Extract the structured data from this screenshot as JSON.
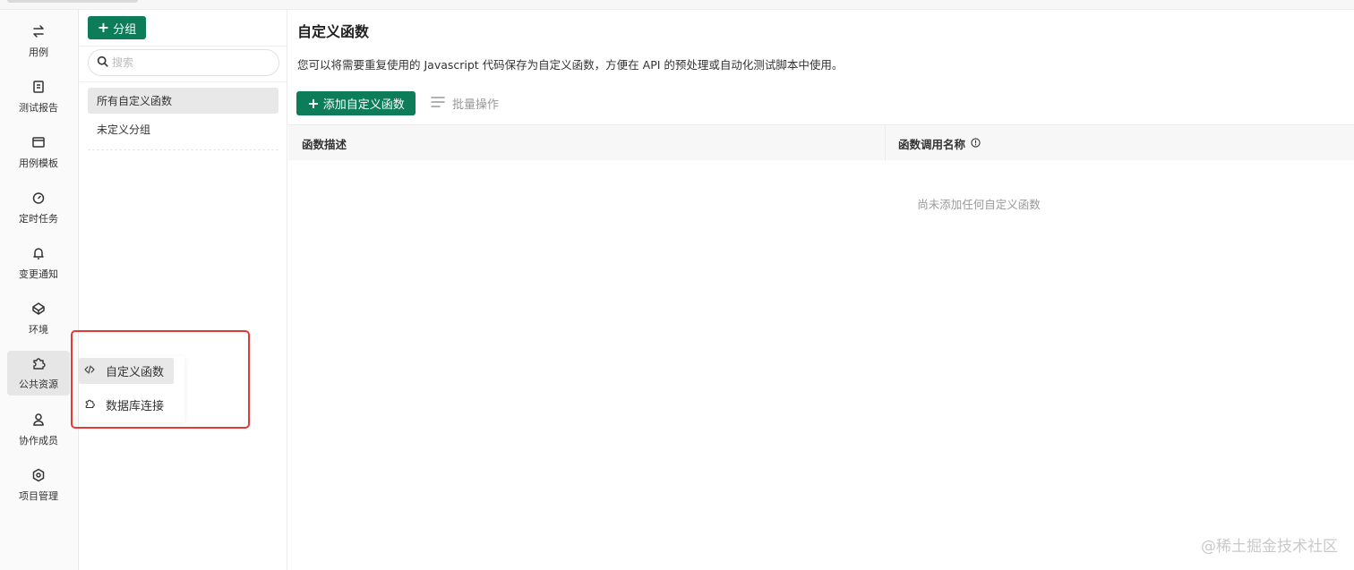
{
  "rail": {
    "items": [
      {
        "label": "用例",
        "icon": "swap-arrows-icon"
      },
      {
        "label": "测试报告",
        "icon": "report-icon"
      },
      {
        "label": "用例模板",
        "icon": "template-icon"
      },
      {
        "label": "定时任务",
        "icon": "timer-icon"
      },
      {
        "label": "变更通知",
        "icon": "bell-icon"
      },
      {
        "label": "环境",
        "icon": "environment-icon"
      },
      {
        "label": "公共资源",
        "icon": "puzzle-icon",
        "active": true
      },
      {
        "label": "协作成员",
        "icon": "members-icon"
      },
      {
        "label": "项目管理",
        "icon": "gear-icon"
      }
    ]
  },
  "groups": {
    "add_label": "分组",
    "search_placeholder": "搜索",
    "items": [
      {
        "label": "所有自定义函数",
        "active": true
      },
      {
        "label": "未定义分组"
      }
    ]
  },
  "main": {
    "title": "自定义函数",
    "description": "您可以将需要重复使用的 Javascript 代码保存为自定义函数，方便在 API 的预处理或自动化测试脚本中使用。",
    "add_button": "添加自定义函数",
    "batch_button": "批量操作",
    "columns": [
      "函数描述",
      "函数调用名称"
    ],
    "empty_text": "尚未添加任何自定义函数"
  },
  "popover": {
    "items": [
      {
        "label": "自定义函数",
        "icon": "code-icon",
        "active": true
      },
      {
        "label": "数据库连接",
        "icon": "puzzle-icon"
      }
    ]
  },
  "watermark": "@稀土掘金技术社区",
  "colors": {
    "accent": "#0c7c59",
    "highlight": "#e53935"
  }
}
